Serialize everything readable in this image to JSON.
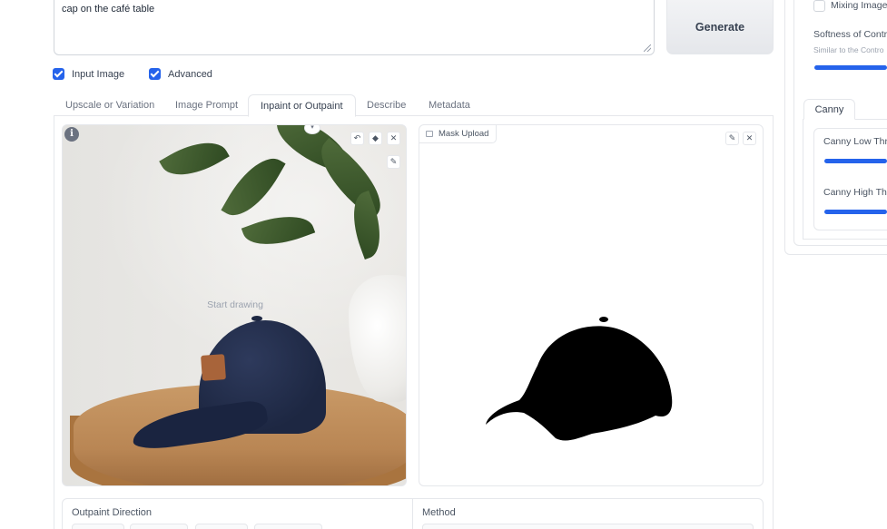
{
  "prompt": {
    "text": "cap on the café table"
  },
  "generate": {
    "label": "Generate"
  },
  "options": {
    "input_image": {
      "label": "Input Image",
      "checked": true
    },
    "advanced": {
      "label": "Advanced",
      "checked": true
    }
  },
  "tabs": [
    {
      "label": "Upscale or Variation",
      "active": false
    },
    {
      "label": "Image Prompt",
      "active": false
    },
    {
      "label": "Inpaint or Outpaint",
      "active": true
    },
    {
      "label": "Describe",
      "active": false
    },
    {
      "label": "Metadata",
      "active": false
    }
  ],
  "canvas": {
    "hint": "Start drawing",
    "info_icon": "info-icon",
    "tools": [
      "undo-icon",
      "eraser-icon",
      "close-icon",
      "brush-icon"
    ]
  },
  "mask": {
    "label": "Mask Upload",
    "tools": [
      "edit-icon",
      "close-icon"
    ]
  },
  "bottom": {
    "outpaint_label": "Outpaint Direction",
    "method_label": "Method"
  },
  "right_panel": {
    "mixing_label": "Mixing Image",
    "softness_label": "Softness of Contro",
    "softness_hint": "Similar to the Contro",
    "canny_tab": "Canny",
    "canny_low": "Canny Low Thr",
    "canny_high": "Canny High Thr"
  },
  "colors": {
    "accent": "#2563eb",
    "border": "#e5e7eb"
  }
}
